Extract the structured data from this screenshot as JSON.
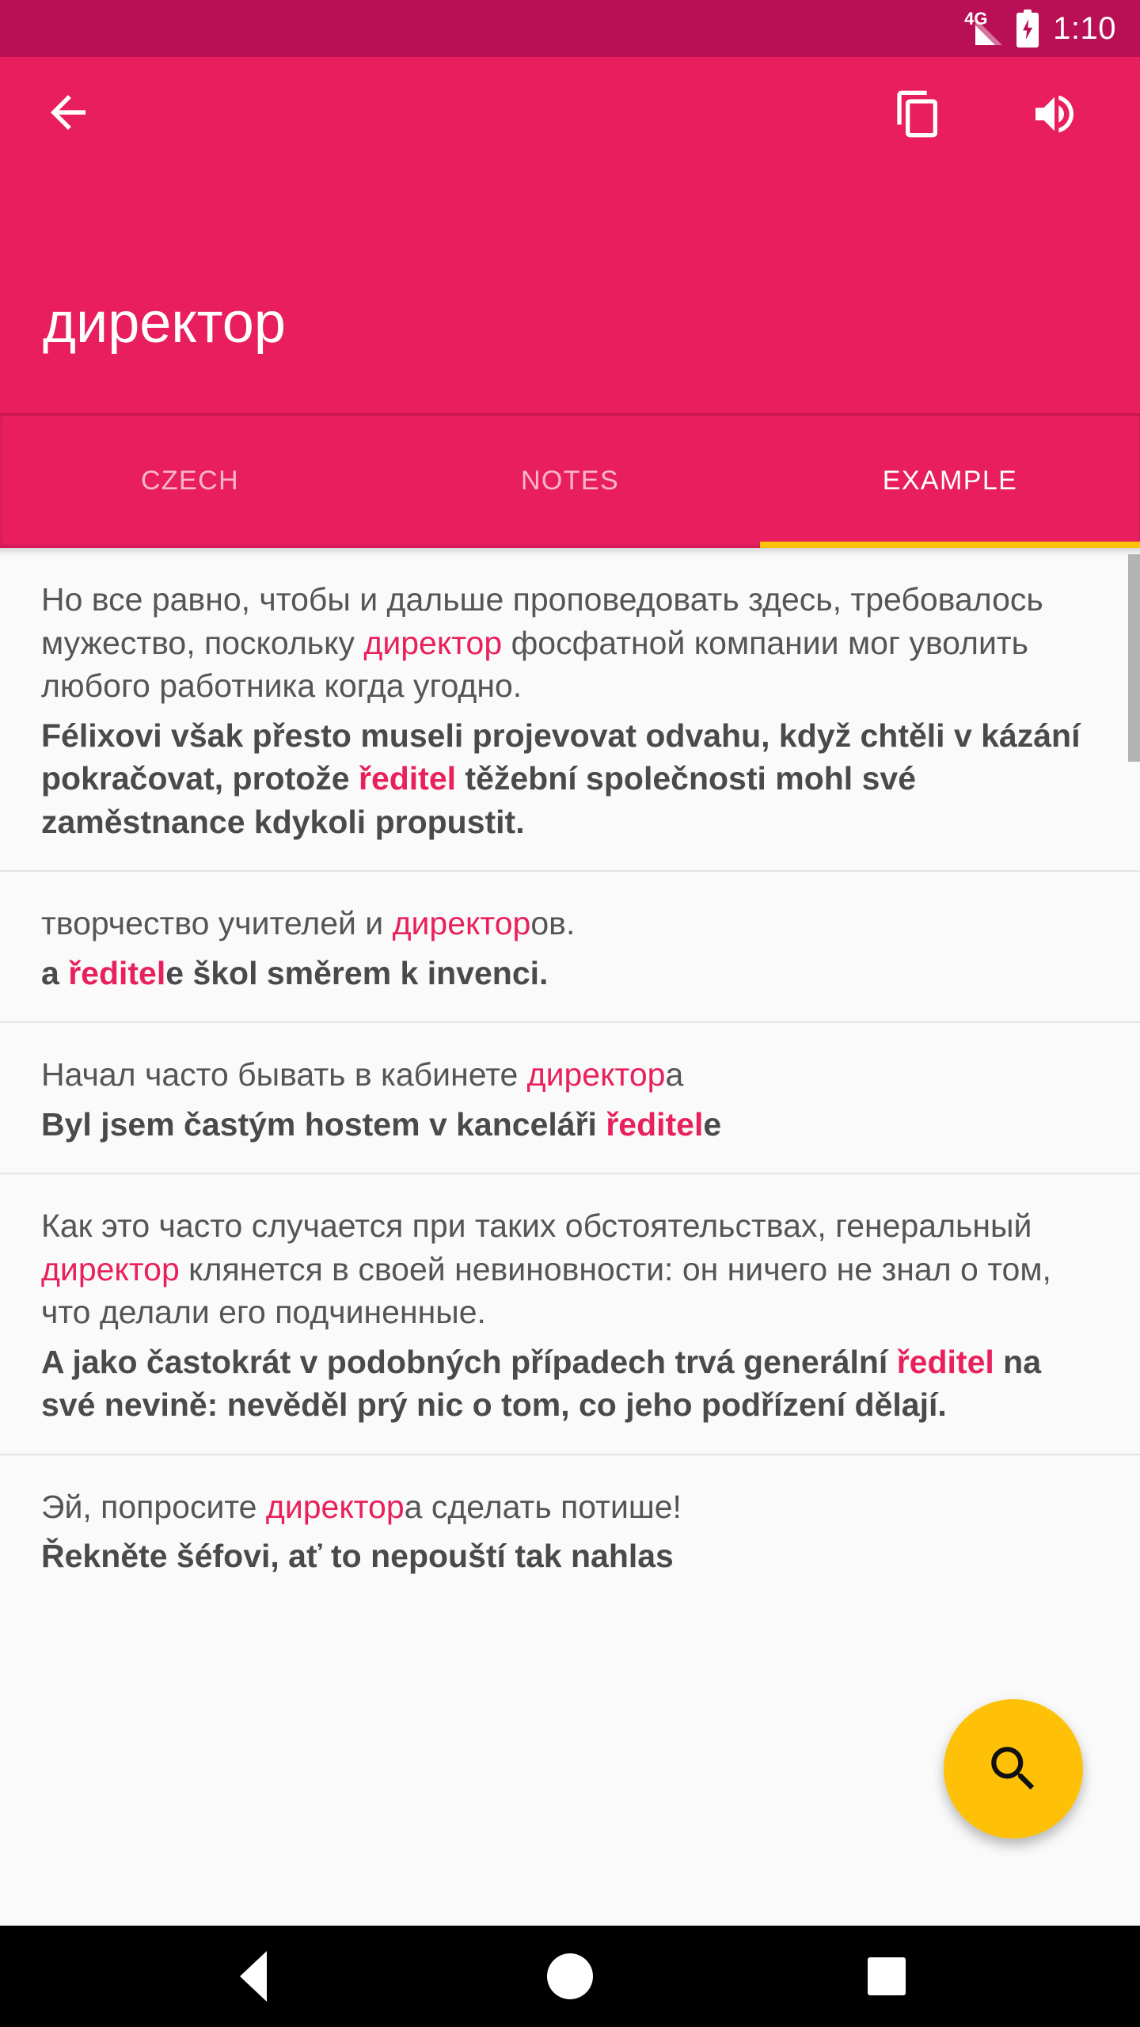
{
  "status_bar": {
    "network": "4G",
    "time": "1:10",
    "battery_icon": "battery-charging-icon",
    "signal_icon": "signal-icon"
  },
  "app_bar": {
    "back_icon": "back-arrow-icon",
    "copy_icon": "copy-icon",
    "sound_icon": "volume-up-icon",
    "headword": "директор",
    "favorite_icon": "heart-outline-icon",
    "accent_color": "#E91E5E",
    "status_color": "#B80F55"
  },
  "tabs": {
    "items": [
      {
        "label": "CZECH",
        "active": false
      },
      {
        "label": "NOTES",
        "active": false
      },
      {
        "label": "EXAMPLE",
        "active": true
      }
    ],
    "indicator_color": "#FFC107"
  },
  "entries": [
    {
      "ru": [
        {
          "t": "Но все равно, чтобы и дальше проповедовать здесь, требовалось мужество, поскольку ",
          "hl": false
        },
        {
          "t": "директор",
          "hl": true
        },
        {
          "t": " фосфатной компании мог уволить любого работника когда угодно.",
          "hl": false
        }
      ],
      "cz": [
        {
          "t": "Félixovi však přesto museli projevovat odvahu, když chtěli v kázání pokračovat, protože ",
          "hl": false
        },
        {
          "t": "ředitel",
          "hl": true
        },
        {
          "t": " těžební společnosti mohl své zaměstnance kdykoli propustit.",
          "hl": false
        }
      ]
    },
    {
      "ru": [
        {
          "t": "творчество учителей и ",
          "hl": false
        },
        {
          "t": "директор",
          "hl": true
        },
        {
          "t": "ов.",
          "hl": false
        }
      ],
      "cz": [
        {
          "t": "a ",
          "hl": false
        },
        {
          "t": "ředitel",
          "hl": true
        },
        {
          "t": "e škol směrem k invenci.",
          "hl": false
        }
      ]
    },
    {
      "ru": [
        {
          "t": "Начал часто бывать в кабинете ",
          "hl": false
        },
        {
          "t": "директор",
          "hl": true
        },
        {
          "t": "а",
          "hl": false
        }
      ],
      "cz": [
        {
          "t": "Byl jsem častým hostem v kanceláři ",
          "hl": false
        },
        {
          "t": "ředitel",
          "hl": true
        },
        {
          "t": "e",
          "hl": false
        }
      ]
    },
    {
      "ru": [
        {
          "t": "Как это часто случается при таких обстоятельствах, генеральный ",
          "hl": false
        },
        {
          "t": "директор",
          "hl": true
        },
        {
          "t": " клянется в своей невиновности: он ничего не знал о том, что делали его подчиненные.",
          "hl": false
        }
      ],
      "cz": [
        {
          "t": "A jako častokrát v podobných případech trvá generální ",
          "hl": false
        },
        {
          "t": "ředitel",
          "hl": true
        },
        {
          "t": " na své nevině: nevěděl prý nic o tom, co jeho podřízení dělají.",
          "hl": false
        }
      ]
    },
    {
      "ru": [
        {
          "t": "Эй, попросите ",
          "hl": false
        },
        {
          "t": "директор",
          "hl": true
        },
        {
          "t": "а сделать потише!",
          "hl": false
        }
      ],
      "cz": [
        {
          "t": "Řekněte šéfovi, ať to nepouští tak nahlas",
          "hl": false
        }
      ]
    }
  ],
  "fab": {
    "icon": "search-icon",
    "color": "#FFC107"
  },
  "nav_bar": {
    "back_icon": "nav-back-triangle-icon",
    "home_icon": "nav-home-circle-icon",
    "recents_icon": "nav-recents-square-icon"
  },
  "highlight_color": "#E8215C"
}
